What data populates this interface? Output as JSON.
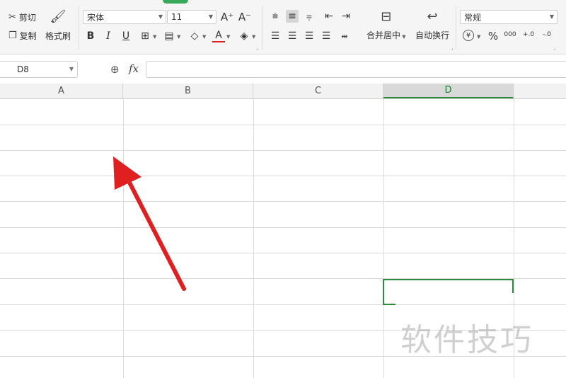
{
  "ribbon": {
    "clipboard": {
      "cut_label": "剪切",
      "copy_label": "复制",
      "format_painter_label": "格式刷"
    },
    "font": {
      "family": "宋体",
      "size": "11",
      "grow_icon": "A⁺",
      "shrink_icon": "A⁻",
      "bold": "B",
      "italic": "I",
      "underline": "U",
      "font_color_icon": "A"
    },
    "alignment": {
      "merge_label": "合并居中",
      "wrap_label": "自动换行"
    },
    "number": {
      "format": "常规",
      "currency": "¥",
      "percent": "%",
      "thousands": "000",
      "inc_decimal": "+.0",
      "dec_decimal": "-.0"
    }
  },
  "formula_bar": {
    "cell_ref": "D8",
    "fx": "fx",
    "formula": ""
  },
  "columns": [
    "A",
    "B",
    "C",
    "D"
  ],
  "active_column": "D",
  "watermark": "软件技巧",
  "colors": {
    "accent": "#2e8b3d",
    "annotation_arrow": "#e02020"
  }
}
